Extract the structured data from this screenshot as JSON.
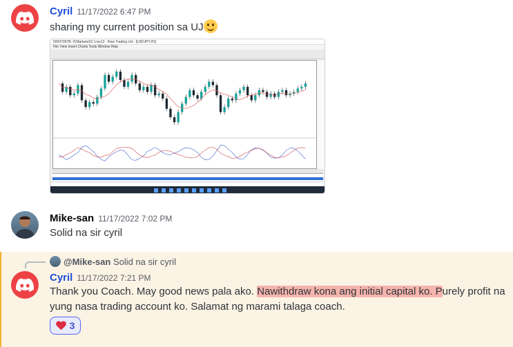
{
  "messages": [
    {
      "author": "Cyril",
      "timestamp": "11/17/2022 6:47 PM",
      "text": "sharing my current position sa UJ",
      "avatar": "discord-logo-icon"
    },
    {
      "author": "Mike-san",
      "timestamp": "11/17/2022 7:02 PM",
      "text": "Solid na sir cyril",
      "avatar": "user-photo"
    },
    {
      "author": "Cyril",
      "timestamp": "11/17/2022 7:21 PM",
      "text_before": "Thank you Coach. May good news pala ako. ",
      "text_highlight": "Nawithdraw kona ang initial capital ko. P",
      "text_after": "urely profit na",
      "text_line2": "yung nasa trading account ko. Salamat ng marami talaga coach.",
      "avatar": "discord-logo-icon",
      "reply_to": {
        "user": "@Mike-san",
        "text": "Solid na sir cyril"
      },
      "reaction": {
        "emoji": "heart-icon",
        "count": "3"
      }
    }
  ],
  "attachment": {
    "window_title": "50097097B: ICMarketsSC-Live12 - Raw Trading Ltd - [USDJPY,H1]",
    "menu": "File  View  Insert  Charts  Tools  Window  Help",
    "symbol": "USDJPY",
    "price_series": [
      140.1,
      139.6,
      139.9,
      139.4,
      139.5,
      140.0,
      139.1,
      138.7,
      139.0,
      138.9,
      139.3,
      139.8,
      140.6,
      140.2,
      140.5,
      140.8,
      140.3,
      139.9,
      140.2,
      140.6,
      140.1,
      139.7,
      139.9,
      139.6,
      140.0,
      139.4,
      139.5,
      139.2,
      138.6,
      138.1,
      137.8,
      138.4,
      138.9,
      139.3,
      139.7,
      139.4,
      139.2,
      139.6,
      139.9,
      140.2,
      140.0,
      139.4,
      138.4,
      138.7,
      139.2,
      139.1,
      139.5,
      139.7,
      139.9,
      139.4,
      139.1,
      139.4,
      139.7,
      139.6,
      139.3,
      139.5,
      139.3,
      139.6,
      139.7,
      139.4,
      139.5,
      139.6,
      139.8,
      139.9,
      140.1
    ],
    "colors": {
      "bull": "#1aa39b",
      "bear": "#1f2a33",
      "title_accent": "#1d4ed8",
      "reply_accent": "#f0b232",
      "highlight": "#f08080"
    }
  }
}
